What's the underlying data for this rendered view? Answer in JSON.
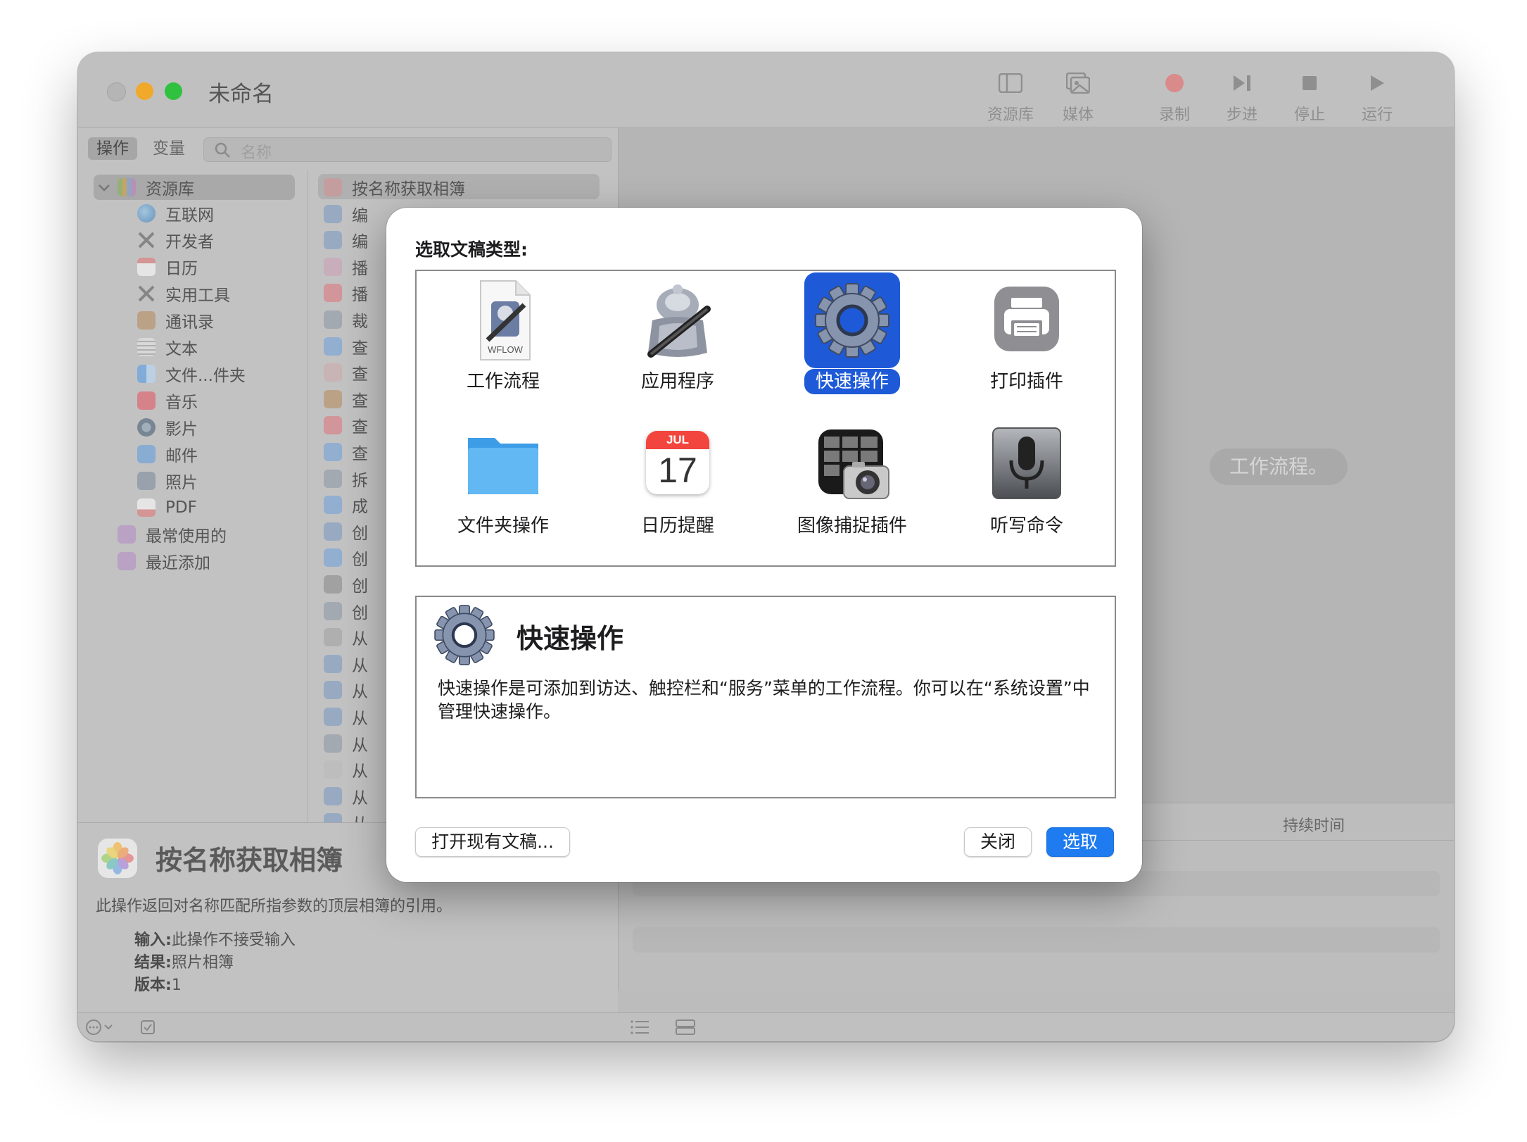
{
  "window": {
    "title": "未命名",
    "toolbar": {
      "library": "资源库",
      "media": "媒体",
      "record": "录制",
      "step": "步进",
      "stop": "停止",
      "run": "运行"
    }
  },
  "sidebar": {
    "tabs": [
      "操作",
      "变量"
    ],
    "search_placeholder": "名称",
    "library_label": "资源库",
    "categories": [
      {
        "label": "互联网",
        "icon": "globe-icon"
      },
      {
        "label": "开发者",
        "icon": "tools-icon"
      },
      {
        "label": "日历",
        "icon": "calendar-icon"
      },
      {
        "label": "实用工具",
        "icon": "tools-icon"
      },
      {
        "label": "通讯录",
        "icon": "contacts-icon"
      },
      {
        "label": "文本",
        "icon": "text-icon"
      },
      {
        "label": "文件...件夹",
        "icon": "finder-icon"
      },
      {
        "label": "音乐",
        "icon": "music-icon"
      },
      {
        "label": "影片",
        "icon": "movie-icon"
      },
      {
        "label": "邮件",
        "icon": "mail-icon"
      },
      {
        "label": "照片",
        "icon": "photos-icon"
      },
      {
        "label": "PDF",
        "icon": "pdf-icon"
      }
    ],
    "smart_groups": [
      "最常使用的",
      "最近添加"
    ],
    "actions": [
      "按名称获取相簿",
      "编",
      "编",
      "播",
      "播",
      "裁",
      "查",
      "查",
      "查",
      "查",
      "查",
      "拆",
      "成",
      "创",
      "创",
      "创",
      "创",
      "从",
      "从",
      "从",
      "从",
      "从",
      "从",
      "从",
      "从"
    ]
  },
  "description": {
    "title": "按名称获取相簿",
    "text": "此操作返回对名称匹配所指参数的顶层相簿的引用。",
    "input_label": "输入:",
    "input_value": "此操作不接受输入",
    "result_label": "结果:",
    "result_value": "照片相簿",
    "version_label": "版本:",
    "version_value": "1"
  },
  "workflow": {
    "drop_hint": "工作流程。",
    "log_duration_col": "持续时间"
  },
  "dialog": {
    "title": "选取文稿类型:",
    "types": [
      {
        "label": "工作流程",
        "icon": "workflow-file-icon"
      },
      {
        "label": "应用程序",
        "icon": "automator-robot-icon"
      },
      {
        "label": "快速操作",
        "icon": "gear-icon"
      },
      {
        "label": "打印插件",
        "icon": "printer-icon"
      },
      {
        "label": "文件夹操作",
        "icon": "folder-icon"
      },
      {
        "label": "日历提醒",
        "icon": "calendar-icon"
      },
      {
        "label": "图像捕捉插件",
        "icon": "image-capture-icon"
      },
      {
        "label": "听写命令",
        "icon": "microphone-icon"
      }
    ],
    "calendar_icon": {
      "month": "JUL",
      "day": "17"
    },
    "workflow_icon_text": "WFLOW",
    "selected": "快速操作",
    "detail_title": "快速操作",
    "detail_text": "快速操作是可添加到访达、触控栏和“服务”菜单的工作流程。你可以在“系统设置”中管理快速操作。",
    "buttons": {
      "open_existing": "打开现有文稿...",
      "close": "关闭",
      "choose": "选取"
    }
  },
  "colors": {
    "accent": "#1e5ad8",
    "primary_button": "#1e7bf0",
    "window_dimmed": "#bcbcbc"
  }
}
